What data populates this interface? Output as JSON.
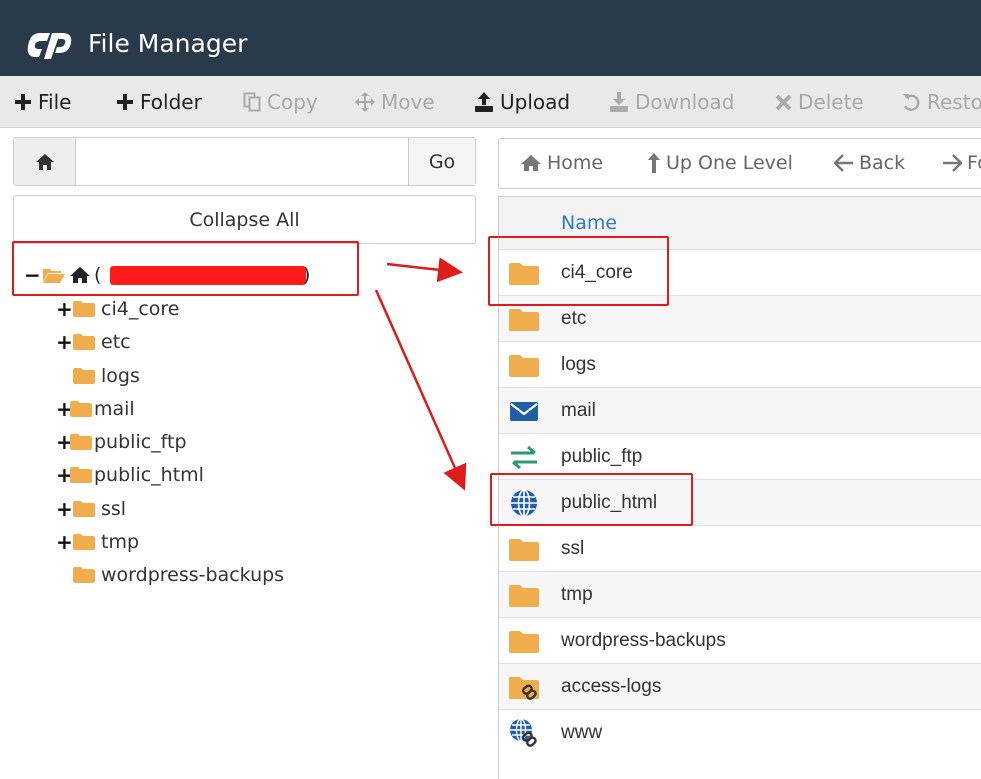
{
  "app": {
    "title": "File Manager"
  },
  "toolbar": {
    "file": "File",
    "folder": "Folder",
    "copy": "Copy",
    "move": "Move",
    "upload": "Upload",
    "download": "Download",
    "delete": "Delete",
    "restore": "Resto"
  },
  "left": {
    "address_value": "",
    "go": "Go",
    "collapse_all": "Collapse All",
    "root_open": "(",
    "root_close": ")",
    "tree": [
      {
        "label": "ci4_core",
        "expandable": true
      },
      {
        "label": "etc",
        "expandable": true
      },
      {
        "label": "logs",
        "expandable": false
      },
      {
        "label": "mail",
        "expandable": true
      },
      {
        "label": "public_ftp",
        "expandable": true
      },
      {
        "label": "public_html",
        "expandable": true
      },
      {
        "label": "ssl",
        "expandable": true
      },
      {
        "label": "tmp",
        "expandable": true
      },
      {
        "label": "wordpress-backups",
        "expandable": false
      }
    ]
  },
  "nav": {
    "home": "Home",
    "up": "Up One Level",
    "back": "Back",
    "forward": "Fo"
  },
  "list": {
    "column_name": "Name",
    "rows": [
      {
        "name": "ci4_core",
        "icon": "folder-icon"
      },
      {
        "name": "etc",
        "icon": "folder-icon"
      },
      {
        "name": "logs",
        "icon": "folder-icon"
      },
      {
        "name": "mail",
        "icon": "envelope-icon"
      },
      {
        "name": "public_ftp",
        "icon": "transfer-arrows-icon"
      },
      {
        "name": "public_html",
        "icon": "globe-icon"
      },
      {
        "name": "ssl",
        "icon": "folder-icon"
      },
      {
        "name": "tmp",
        "icon": "folder-icon"
      },
      {
        "name": "wordpress-backups",
        "icon": "folder-icon"
      },
      {
        "name": "access-logs",
        "icon": "folder-link-icon"
      },
      {
        "name": "www",
        "icon": "globe-link-icon"
      }
    ]
  },
  "colors": {
    "header_bg": "#293a4a",
    "folder": "#f0ad4e",
    "annotation": "#e01b1b",
    "link_blue": "#337ab7"
  }
}
